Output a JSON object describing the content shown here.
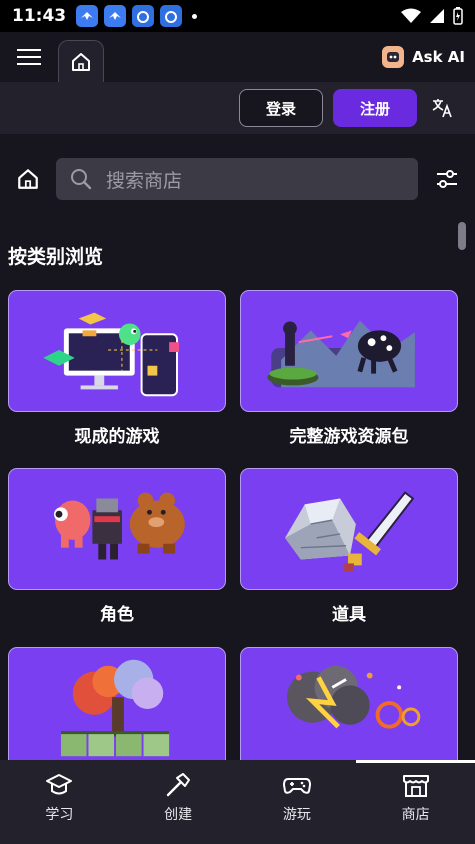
{
  "status": {
    "time": "11:43"
  },
  "topbar": {
    "ask_ai_label": "Ask AI"
  },
  "auth": {
    "login_label": "登录",
    "register_label": "注册"
  },
  "search": {
    "placeholder": "搜索商店"
  },
  "section": {
    "title": "按类别浏览"
  },
  "categories": [
    {
      "label": "现成的游戏"
    },
    {
      "label": "完整游戏资源包"
    },
    {
      "label": "角色"
    },
    {
      "label": "道具"
    },
    {
      "label": ""
    },
    {
      "label": ""
    }
  ],
  "bottom_nav": [
    {
      "label": "学习"
    },
    {
      "label": "创建"
    },
    {
      "label": "游玩"
    },
    {
      "label": "商店"
    }
  ],
  "colors": {
    "accent": "#6a2be0",
    "card_bg": "#7a3ff0",
    "bg": "#17151d"
  }
}
